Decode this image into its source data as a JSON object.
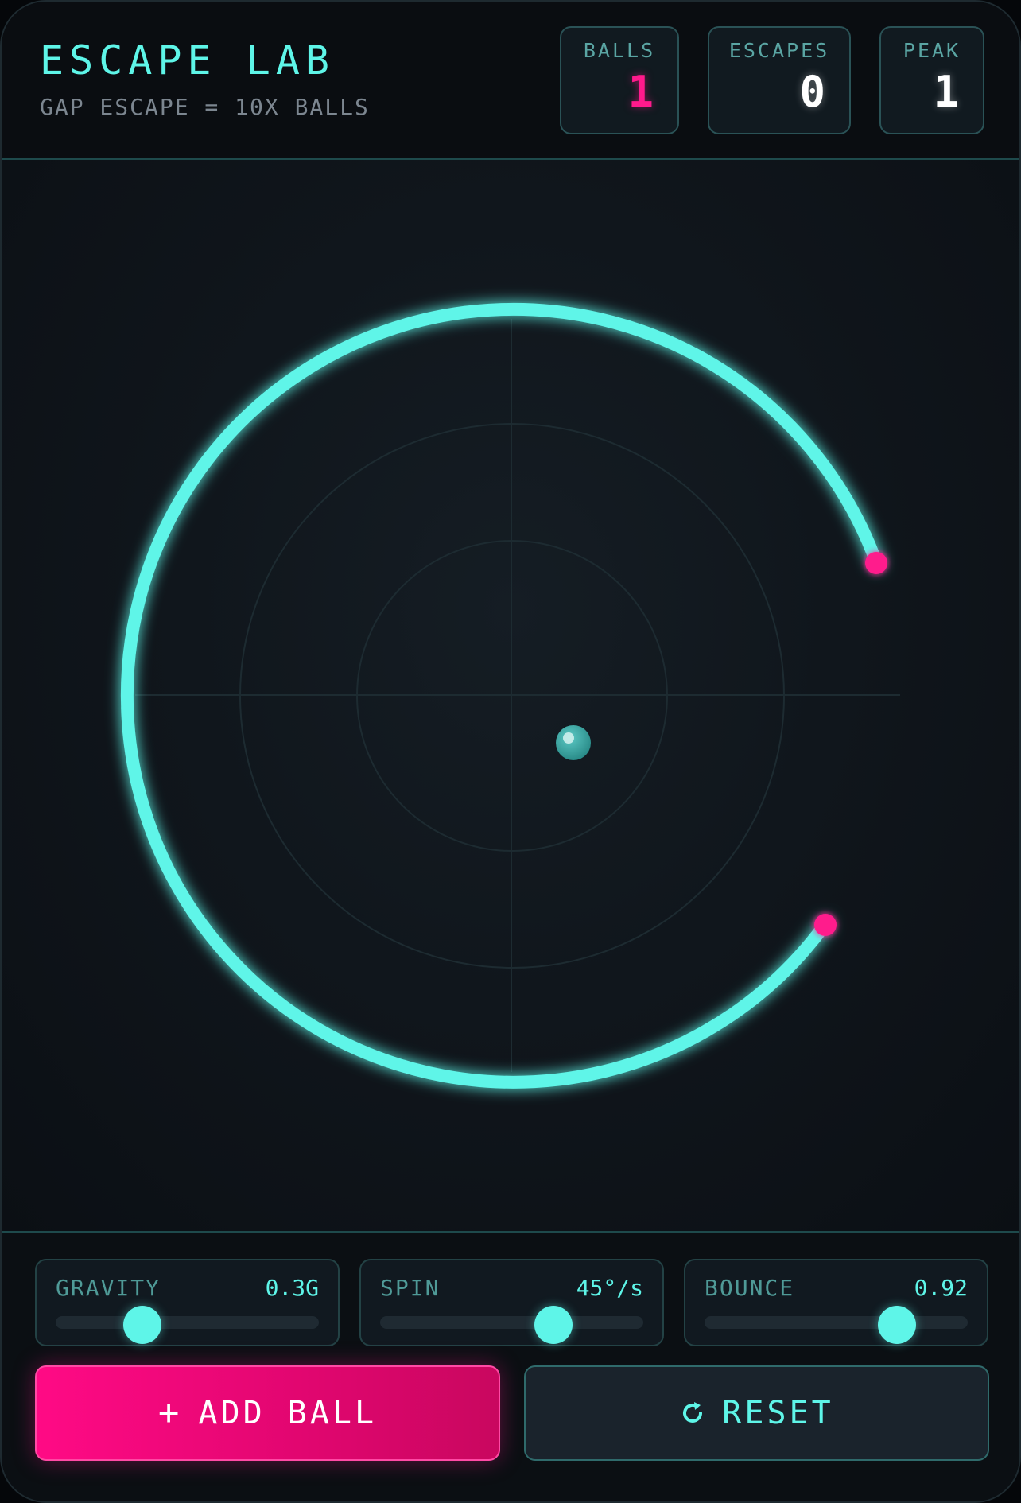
{
  "header": {
    "title": "ESCAPE LAB",
    "subtitle": "GAP ESCAPE = 10X BALLS"
  },
  "stats": [
    {
      "label": "BALLS",
      "value": "1"
    },
    {
      "label": "ESCAPES",
      "value": "0"
    },
    {
      "label": "PEAK",
      "value": "1"
    }
  ],
  "arena": {
    "ring_color": "#5ef5e8",
    "gap_marker_color": "#ff1a8c",
    "ball_color": "#3aa7a4"
  },
  "controls": {
    "sliders": [
      {
        "label": "GRAVITY",
        "value": "0.3G",
        "fraction": 0.33
      },
      {
        "label": "SPIN",
        "value": "45°/s",
        "fraction": 0.66
      },
      {
        "label": "BOUNCE",
        "value": "0.92",
        "fraction": 0.73
      }
    ],
    "add_ball_label": "ADD BALL",
    "reset_label": "RESET"
  },
  "icons": {
    "add": "plus-icon",
    "reset": "refresh-icon"
  },
  "colors": {
    "accent": "#5ef5e8",
    "pink": "#ff1a8c",
    "background": "#0d1116"
  }
}
